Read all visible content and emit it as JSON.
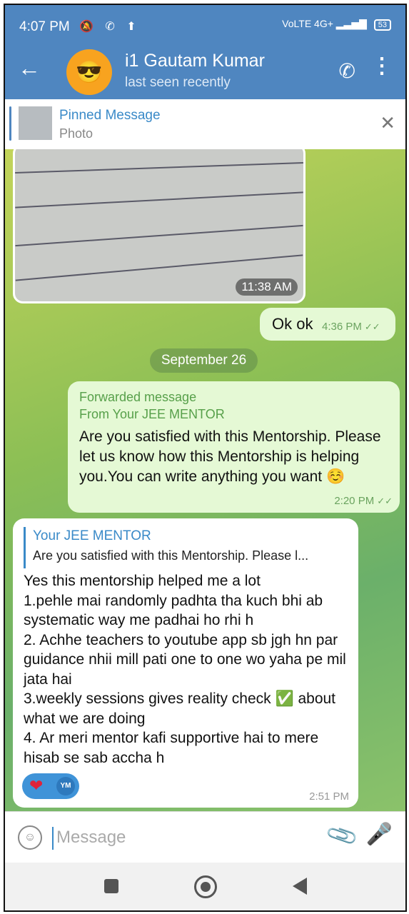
{
  "status_bar": {
    "time": "4:07 PM",
    "left_icons": "🔕 ✆ ⬆",
    "network": "VoLTE 4G+ ▂▃▅▇",
    "battery": "53"
  },
  "header": {
    "back_icon": "←",
    "avatar_emoji": "😎",
    "name": "i1 Gautam Kumar",
    "status": "last seen recently",
    "call_icon": "✆",
    "more_icon": "⋮"
  },
  "pinned": {
    "title": "Pinned Message",
    "subtitle": "Photo",
    "close_icon": "✕"
  },
  "messages": {
    "photo": {
      "time": "11:38 AM"
    },
    "okok": {
      "text": "Ok ok",
      "time": "4:36 PM"
    },
    "date_chip": "September 26",
    "forwarded": {
      "label": "Forwarded message",
      "from": "From Your JEE MENTOR",
      "text": "Are you satisfied with this Mentorship. Please let us know how this Mentorship is helping you.You can write anything you want ☺️",
      "time": "2:20 PM"
    },
    "reply": {
      "quote_author": "Your JEE MENTOR",
      "quote_text": "Are you satisfied with this Mentorship. Please l...",
      "text": "Yes this mentorship helped me a lot\n1.pehle mai randomly padhta tha kuch bhi ab systematic way me padhai ho rhi h\n2. Achhe teachers to youtube app sb jgh hn par guidance nhii mill pati one to one wo yaha pe mil jata hai\n3.weekly sessions gives reality check ✅ about what we are doing\n4. Ar meri mentor kafi supportive hai to mere hisab se sab accha h",
      "reaction_emoji": "❤",
      "reaction_user": "YM",
      "time": "2:51 PM"
    }
  },
  "composer": {
    "placeholder": "Message",
    "emoji_icon": "☺",
    "attach_icon": "📎",
    "mic_icon": "🎤"
  },
  "icons": {
    "read_check": "✓✓"
  }
}
